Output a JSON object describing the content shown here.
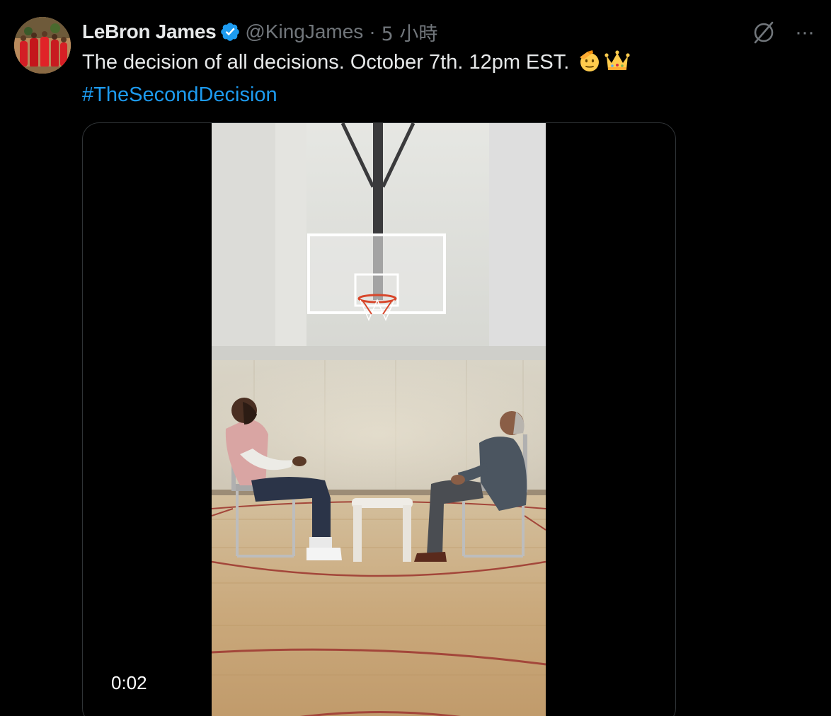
{
  "author": {
    "display_name": "LeBron James",
    "handle": "@KingJames",
    "verified_icon": "verified-badge-icon",
    "avatar_icon": "avatar-photo"
  },
  "meta": {
    "separator": "·",
    "time": "5 小時"
  },
  "actions": {
    "grok_icon": "grok-icon",
    "more_icon": "more-horizontal-icon",
    "more_label": "···"
  },
  "tweet": {
    "text": "The decision of all decisions. October 7th. 12pm EST.",
    "emojis": [
      "saluting-face-emoji",
      "crown-emoji"
    ],
    "hashtag": "#TheSecondDecision"
  },
  "video": {
    "timecode": "0:02"
  },
  "colors": {
    "background": "#000000",
    "text": "#e7e9ea",
    "muted": "#71767b",
    "link": "#1d9bf0",
    "verified": "#1d9bf0",
    "media_border": "#2f3336"
  }
}
